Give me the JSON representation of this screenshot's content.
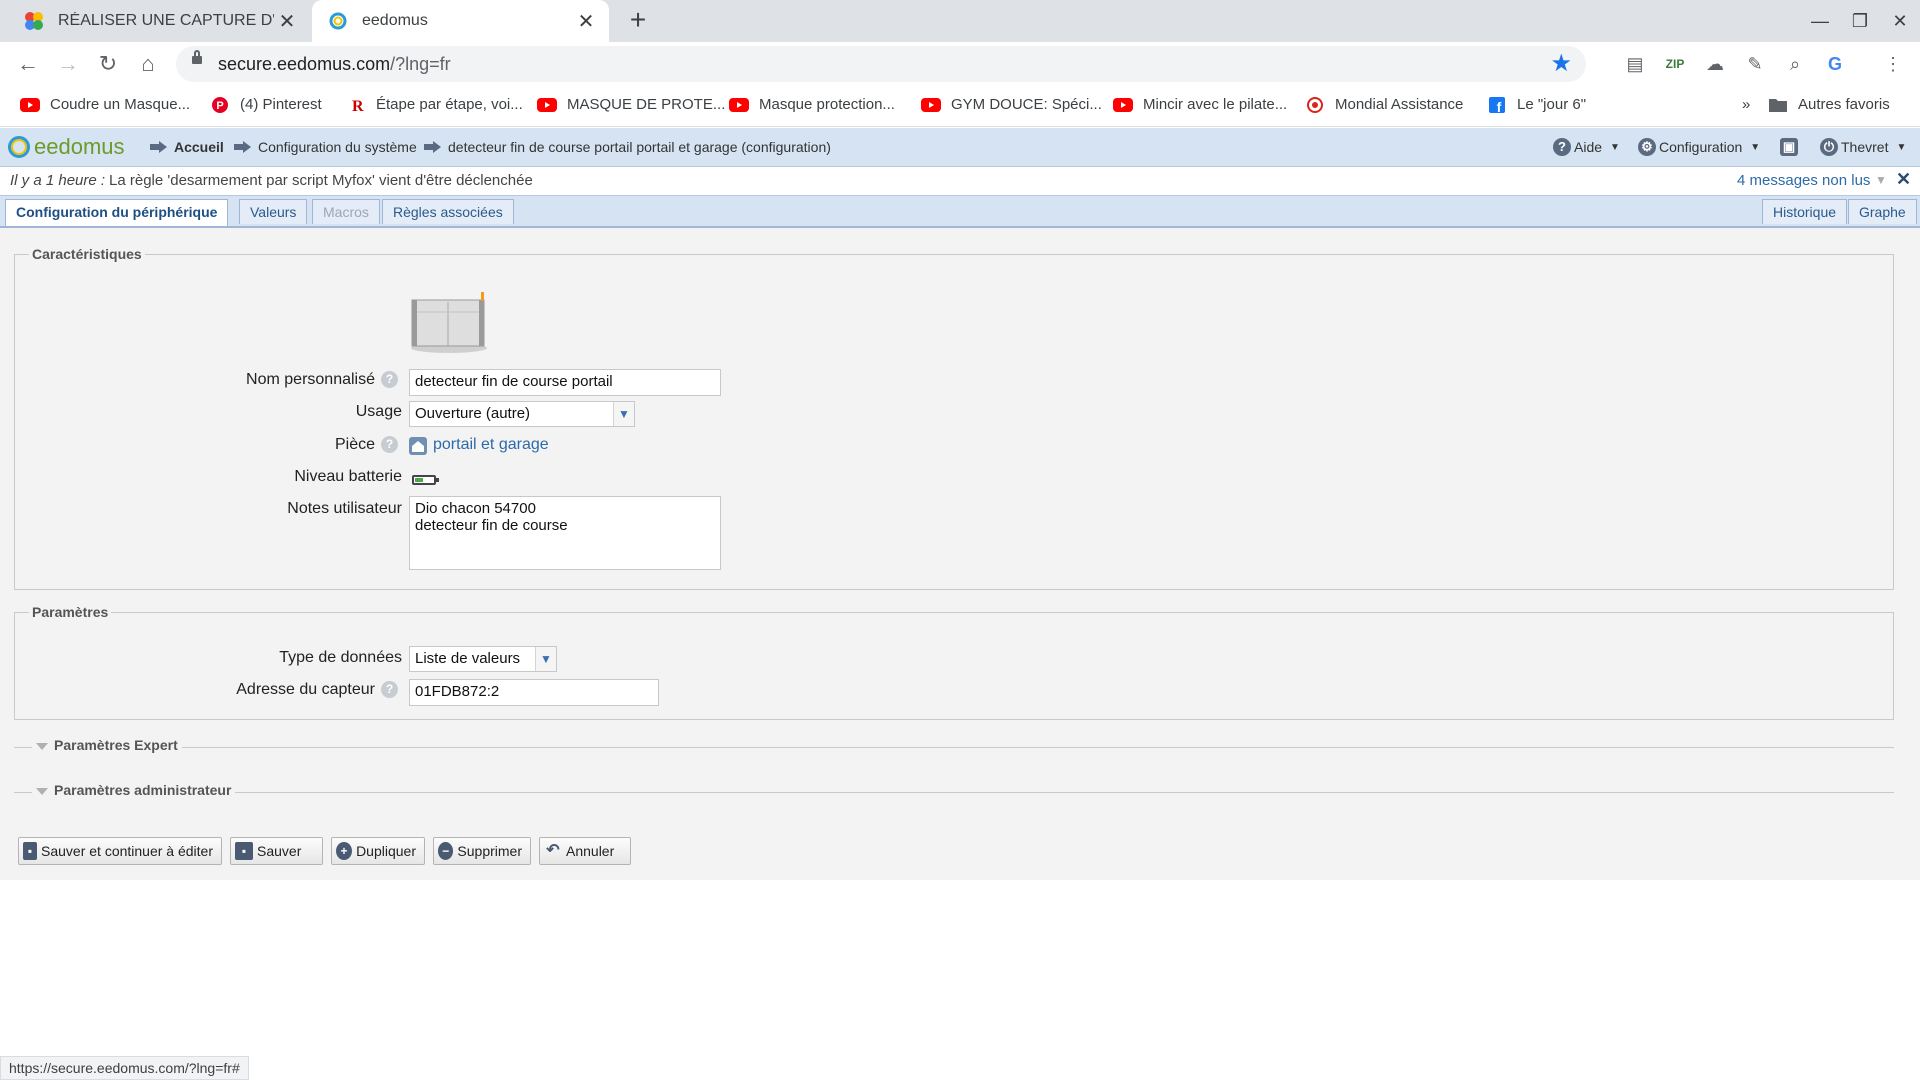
{
  "browser": {
    "tabs": [
      {
        "title": "RÉALISER UNE CAPTURE D'ÉCRAN",
        "active": false
      },
      {
        "title": "eedomus",
        "active": true
      }
    ],
    "url_host": "secure.eedomus.com",
    "url_path": "/?lng=fr",
    "bookmarks": [
      {
        "label": "Coudre un Masque...",
        "icon": "youtube-icon"
      },
      {
        "label": "(4) Pinterest",
        "icon": "pinterest-icon"
      },
      {
        "label": "Étape par étape, voi...",
        "icon": "r-icon"
      },
      {
        "label": "MASQUE DE PROTE...",
        "icon": "youtube-icon"
      },
      {
        "label": "Masque protection...",
        "icon": "youtube-icon"
      },
      {
        "label": "GYM DOUCE: Spéci...",
        "icon": "youtube-icon"
      },
      {
        "label": "Mincir avec le pilate...",
        "icon": "youtube-icon"
      },
      {
        "label": "Mondial Assistance",
        "icon": "mondial-icon"
      },
      {
        "label": "Le \"jour 6\"",
        "icon": "facebook-icon"
      }
    ],
    "more_bookmarks": "»",
    "other_bookmarks": "Autres favoris",
    "status_url": "https://secure.eedomus.com/?lng=fr#"
  },
  "app": {
    "logo_text": "eedomus",
    "breadcrumbs": [
      "Accueil",
      "Configuration du système",
      "detecteur fin de course portail portail et garage (configuration)"
    ],
    "menu": {
      "help": "Aide",
      "config": "Configuration",
      "user": "Thevret"
    },
    "notification": {
      "when": "Il y a 1 heure :",
      "message": "La règle 'desarmement par script Myfox' vient d'être déclenchée",
      "unread": "4 messages non lus"
    },
    "tabs": [
      "Configuration du périphérique",
      "Valeurs",
      "Macros",
      "Règles associées"
    ],
    "right_tabs": [
      "Historique",
      "Graphe"
    ],
    "characteristics": {
      "legend": "Caractéristiques",
      "name_label": "Nom personnalisé",
      "name_value": "detecteur fin de course portail",
      "usage_label": "Usage",
      "usage_value": "Ouverture (autre)",
      "room_label": "Pièce",
      "room_value": "portail et garage",
      "battery_label": "Niveau batterie",
      "battery_level": 0.5,
      "notes_label": "Notes utilisateur",
      "notes_value": "Dio chacon 54700\ndetecteur fin de course"
    },
    "parameters": {
      "legend": "Paramètres",
      "datatype_label": "Type de données",
      "datatype_value": "Liste de valeurs",
      "address_label": "Adresse du capteur",
      "address_value": "01FDB872:2"
    },
    "expert_title": "Paramètres Expert",
    "admin_title": "Paramètres administrateur",
    "buttons": {
      "save_continue": "Sauver et continuer à éditer",
      "save": "Sauver",
      "duplicate": "Dupliquer",
      "delete": "Supprimer",
      "cancel": "Annuler"
    }
  }
}
